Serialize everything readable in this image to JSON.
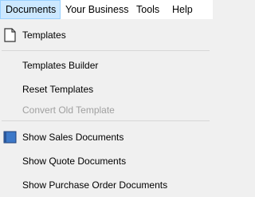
{
  "menubar": {
    "items": [
      {
        "label": "Documents"
      },
      {
        "label": "Your Business"
      },
      {
        "label": "Tools"
      },
      {
        "label": "Help"
      }
    ]
  },
  "menu": {
    "items": [
      {
        "label": "Templates",
        "icon": "document-icon"
      },
      {
        "label": "Templates Builder"
      },
      {
        "label": "Reset Templates"
      },
      {
        "label": "Convert Old Template",
        "disabled": true
      },
      {
        "label": "Show Sales Documents",
        "icon": "book-icon"
      },
      {
        "label": "Show Quote Documents"
      },
      {
        "label": "Show Purchase Order Documents"
      }
    ]
  },
  "colors": {
    "menubar_active_bg": "#cce8ff",
    "menu_bg": "#f0f0f0",
    "disabled_text": "#a0a0a0",
    "book_icon_blue": "#3c78c8"
  }
}
